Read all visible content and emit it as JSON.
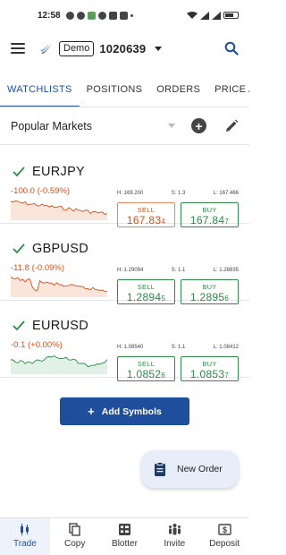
{
  "status": {
    "time": "12:58",
    "battery": "88"
  },
  "header": {
    "demo_label": "Demo",
    "account_number": "1020639"
  },
  "tabs": [
    {
      "label": "WATCHLISTS",
      "active": true
    },
    {
      "label": "POSITIONS",
      "active": false
    },
    {
      "label": "ORDERS",
      "active": false
    },
    {
      "label": "PRICE ALERTS",
      "active": false
    }
  ],
  "watchlist": {
    "name": "Popular Markets"
  },
  "symbols": [
    {
      "name": "EURJPY",
      "change": "-100.0 (-0.59%)",
      "high": "H: 169.200",
      "spread": "S: 1.3",
      "low": "L: 167.466",
      "sell_label": "SELL",
      "sell_main": "167.83",
      "sell_pip": "4",
      "buy_label": "BUY",
      "buy_main": "167.84",
      "buy_pip": "7",
      "trend": "down"
    },
    {
      "name": "GBPUSD",
      "change": "-11.8 (-0.09%)",
      "high": "H: 1.29094",
      "spread": "S: 1.1",
      "low": "L: 1.28835",
      "sell_label": "SELL",
      "sell_main": "1.2894",
      "sell_pip": "5",
      "buy_label": "BUY",
      "buy_main": "1.2895",
      "buy_pip": "6",
      "trend": "down"
    },
    {
      "name": "EURUSD",
      "change": "-0.1 (+0.00%)",
      "high": "H: 1.08540",
      "spread": "S: 1.1",
      "low": "L: 1.08412",
      "sell_label": "SELL",
      "sell_main": "1.0852",
      "sell_pip": "6",
      "buy_label": "BUY",
      "buy_main": "1.0853",
      "buy_pip": "7",
      "trend": "flat"
    }
  ],
  "add_symbols_label": "Add Symbols",
  "new_order_label": "New Order",
  "nav": [
    {
      "label": "Trade",
      "icon": "candlestick-icon",
      "active": true
    },
    {
      "label": "Copy",
      "icon": "copy-icon",
      "active": false
    },
    {
      "label": "Blotter",
      "icon": "grid-icon",
      "active": false
    },
    {
      "label": "Invite",
      "icon": "people-icon",
      "active": false
    },
    {
      "label": "Deposit",
      "icon": "dollar-icon",
      "active": false
    }
  ],
  "colors": {
    "accent": "#1f4f9c",
    "sell": "#d2501e",
    "buy": "#2e8a49",
    "fab_bg": "#e7eef9"
  }
}
